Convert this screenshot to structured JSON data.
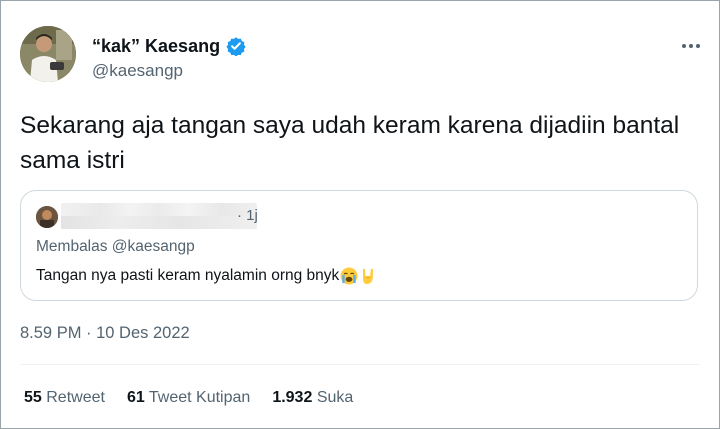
{
  "author": {
    "name": "“kak” Kaesang",
    "handle": "@kaesangp",
    "verified_color": "#1d9bf0"
  },
  "tweet": {
    "text": "Sekarang aja tangan saya udah keram karena dijadiin bantal sama istri",
    "timestamp": "8.59 PM · 10 Des 2022"
  },
  "quoted": {
    "time": "· 1j",
    "replying_to": "Membalas @kaesangp",
    "text": "Tangan nya pasti keram nyalamin orng bnyk",
    "emojis": [
      "loudly-crying-face",
      "sign-of-the-horns"
    ]
  },
  "stats": {
    "retweets_count": "55",
    "retweets_label": "Retweet",
    "quotes_count": "61",
    "quotes_label": "Tweet Kutipan",
    "likes_count": "1.932",
    "likes_label": "Suka"
  },
  "icons": {
    "more": "more-horizontal-icon",
    "verified": "verified-badge-icon"
  }
}
